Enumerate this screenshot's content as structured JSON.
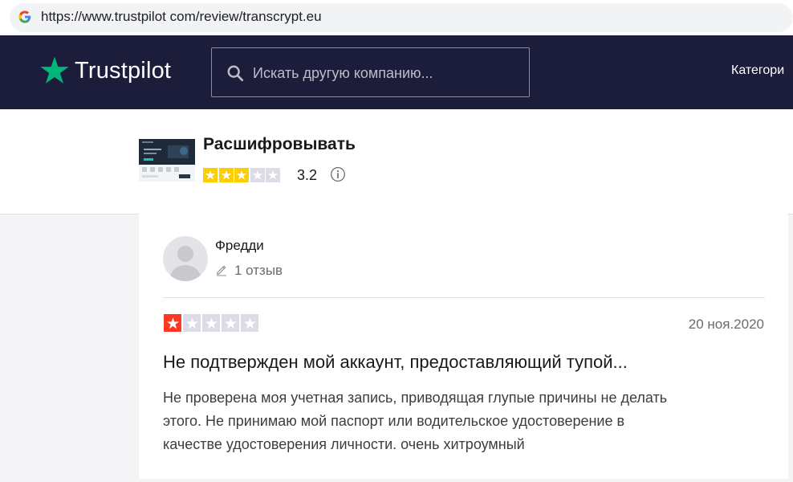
{
  "browser": {
    "url": "https://www.trustpilot com/review/transcrypt.eu"
  },
  "header": {
    "logo_text": "Trustpilot",
    "search_placeholder": "Искать другую компанию...",
    "nav_categories": "Категори"
  },
  "company": {
    "name": "Расшифровывать",
    "score": "3.2",
    "stars_filled": 3,
    "stars_total": 5
  },
  "review": {
    "author": "Фредди",
    "review_count": "1 отзыв",
    "rating": 1,
    "date": "20 ноя.2020",
    "title": "Не подтвержден мой аккаунт, предоставляющий тупой...",
    "body_lines": [
      "Не проверена моя учетная запись, приводящая глупые причины не делать",
      "этого. Не принимаю мой паспорт или водительское удостоверение в",
      "качестве удостоверения личности. очень хитроумный"
    ]
  },
  "colors": {
    "header_bg": "#1c1c3b",
    "trustpilot_green": "#00b67a",
    "star_yellow": "#ffce00",
    "star_red": "#ff3722",
    "star_empty": "#dcdce6"
  },
  "icons": [
    "google-icon",
    "trustpilot-star-icon",
    "search-icon",
    "info-icon",
    "pencil-icon",
    "avatar-placeholder-icon",
    "star-icon"
  ]
}
